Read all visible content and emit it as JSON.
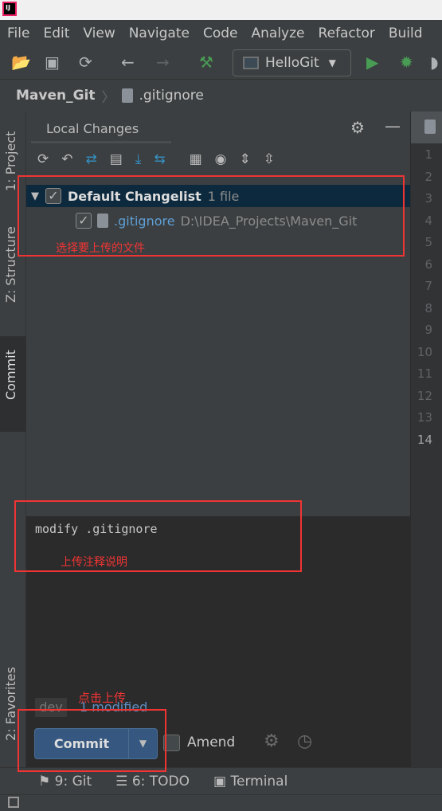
{
  "menu": [
    "File",
    "Edit",
    "View",
    "Navigate",
    "Code",
    "Analyze",
    "Refactor",
    "Build"
  ],
  "toolbar": {
    "run_config": "HelloGit"
  },
  "breadcrumb": {
    "project": "Maven_Git",
    "file": ".gitignore"
  },
  "side_tabs": {
    "project": "1: Project",
    "structure": "Z: Structure",
    "commit": "Commit",
    "favorites": "2: Favorites"
  },
  "panel": {
    "tab": "Local Changes"
  },
  "changelist": {
    "name": "Default Changelist",
    "count": "1 file",
    "file": ".gitignore",
    "path": "D:\\IDEA_Projects\\Maven_Git"
  },
  "commit_message": "modify .gitignore",
  "status": {
    "branch": "dev",
    "modified": "1 modified"
  },
  "commit": {
    "label": "Commit",
    "amend": "Amend"
  },
  "bottom_tabs": [
    "9: Git",
    "6: TODO",
    "Terminal"
  ],
  "line_numbers": [
    "1",
    "2",
    "3",
    "4",
    "5",
    "6",
    "7",
    "8",
    "9",
    "10",
    "11",
    "12",
    "13",
    "14"
  ],
  "annotations": {
    "select_files": "选择要上传的文件",
    "message_note": "上传注释说明",
    "click_commit": "点击上传"
  },
  "colors": {
    "accent": "#365880",
    "selection": "#0d293e",
    "annotation": "#f03434"
  }
}
